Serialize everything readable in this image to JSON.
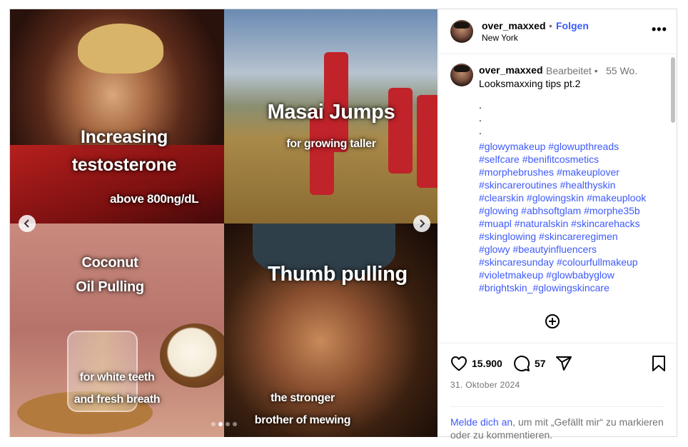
{
  "post": {
    "username": "over_maxxed",
    "separator": "•",
    "follow_label": "Folgen",
    "location": "New York",
    "more_label": "•••"
  },
  "media": {
    "panels": [
      {
        "title_lines": [
          "Increasing",
          "testosterone"
        ],
        "subtitle": "above 800ng/dL"
      },
      {
        "title": "Masai Jumps",
        "subtitle": "for growing taller"
      },
      {
        "title_lines": [
          "Coconut",
          "Oil Pulling"
        ],
        "subtitle_lines": [
          "for white teeth",
          "and fresh breath"
        ]
      },
      {
        "title": "Thumb pulling",
        "subtitle_lines": [
          "the stronger",
          "brother of mewing"
        ]
      }
    ],
    "prev_icon": "chevron-left-icon",
    "next_icon": "chevron-right-icon",
    "slide_count": 4,
    "active_slide": 2
  },
  "caption": {
    "username": "over_maxxed",
    "edited": "Bearbeitet •",
    "time": "55 Wo.",
    "text": "Looksmaxxing tips pt.2",
    "dots": [
      ".",
      ".",
      "."
    ],
    "hashtags": [
      "#glowymakeup #glowupthreads",
      "#selfcare #benifitcosmetics",
      "#morphebrushes #makeuplover",
      "#skincareroutines #healthyskin",
      "#clearskin #glowingskin #makeuplook",
      "#glowing #abhsoftglam #morphe35b",
      "#muapl #naturalskin #skincarehacks",
      "#skinglowing #skincareregimen",
      "#glowy #beautyinfluencers",
      "#skincaresunday #colourfullmakeup",
      "#violetmakeup #glowbabyglow",
      "#brightskin_#glowingskincare"
    ]
  },
  "actions": {
    "likes": "15.900",
    "comments": "57",
    "date": "31. Oktober 2024"
  },
  "login_prompt": {
    "link": "Melde dich an",
    "text": ", um mit „Gefällt mir“ zu markieren oder zu kommentieren."
  }
}
